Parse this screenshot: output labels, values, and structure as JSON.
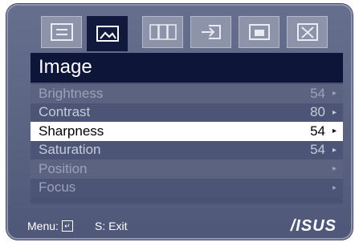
{
  "tabs": [
    {
      "name": "splendid",
      "active": false
    },
    {
      "name": "image",
      "active": true
    },
    {
      "name": "color",
      "active": false
    },
    {
      "name": "input-select",
      "active": false
    },
    {
      "name": "pip",
      "active": false
    },
    {
      "name": "system-setup",
      "active": false
    }
  ],
  "panel": {
    "title": "Image",
    "items": [
      {
        "label": "Brightness",
        "value": "54",
        "arrow": "▸",
        "state": "dim"
      },
      {
        "label": "Contrast",
        "value": "80",
        "arrow": "▸",
        "state": "normal"
      },
      {
        "label": "Sharpness",
        "value": "54",
        "arrow": "▸",
        "state": "highlighted"
      },
      {
        "label": "Saturation",
        "value": "54",
        "arrow": "▸",
        "state": "normal"
      },
      {
        "label": "Position",
        "value": "",
        "arrow": "▸",
        "state": "dim"
      },
      {
        "label": "Focus",
        "value": "",
        "arrow": "▸",
        "state": "dim"
      }
    ]
  },
  "footer": {
    "menu_label": "Menu:",
    "exit_label": "S: Exit",
    "brand": "/ISUS"
  },
  "colors": {
    "frame": "#5a6282",
    "title_bar": "#0d1538",
    "highlight": "#ffffff",
    "active_tab": "#111a3c"
  }
}
